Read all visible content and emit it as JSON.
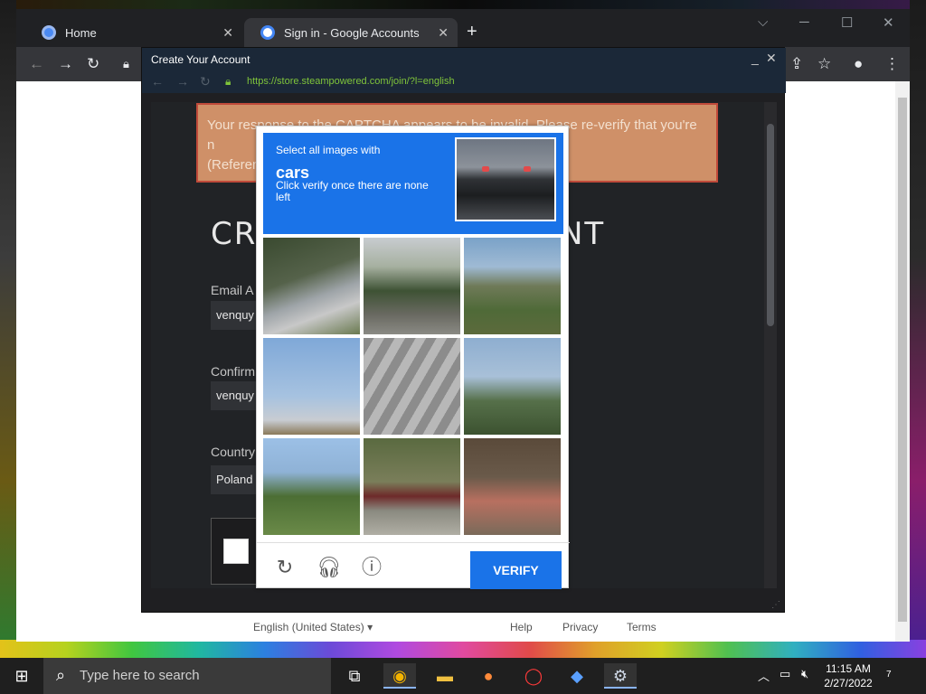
{
  "browser": {
    "tabs": [
      {
        "label": "Home",
        "active": false
      },
      {
        "label": "Sign in - Google Accounts",
        "active": true
      }
    ],
    "new_tab": "+",
    "footer": {
      "language": "English (United States)",
      "links": [
        "Help",
        "Privacy",
        "Terms"
      ]
    }
  },
  "steam_window": {
    "title": "Create Your Account",
    "url": "https://store.steampowered.com/join/?l=english",
    "error_text": "Your response to the CAPTCHA appears to be invalid. Please re-verify that you're n",
    "error_text_2": "(Referen",
    "heading_left": "CRE",
    "heading_right": "NT",
    "fields": [
      {
        "label": "Email A",
        "value": "venquy"
      },
      {
        "label": "Confirm",
        "value": "venquy"
      },
      {
        "label": "Country",
        "value": "Poland"
      }
    ]
  },
  "captcha": {
    "instruction": "Select all images with",
    "target": "cars",
    "hint": "Click verify once there are none left",
    "verify_label": "VERIFY",
    "tiles": [
      "crosswalk-street",
      "palm-tree-house",
      "palm-trees-building",
      "sky-pole",
      "crosswalk-stripes",
      "overpass-bridge",
      "palm-tree-pole",
      "red-car-road",
      "fire-hydrant"
    ]
  },
  "taskbar": {
    "search_placeholder": "Type here to search",
    "time": "11:15 AM",
    "date": "2/27/2022",
    "notifications": "7"
  }
}
